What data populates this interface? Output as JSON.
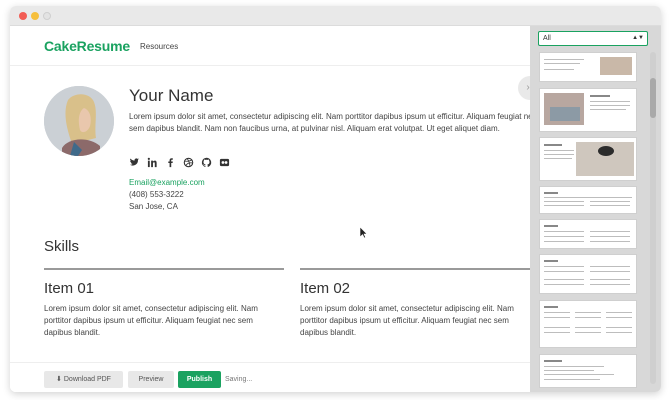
{
  "app": {
    "logo": "CakeResume",
    "nav_resources": "Resources"
  },
  "profile": {
    "name": "Your Name",
    "bio": "Lorem ipsum dolor sit amet, consectetur adipiscing elit. Nam porttitor dapibus ipsum ut efficitur. Aliquam feugiat nec sem dapibus blandit. Nam non faucibus urna, at pulvinar nisl. Aliquam erat volutpat. Ut eget aliquet diam.",
    "email": "Email@example.com",
    "phone": "(408) 553-3222",
    "city": "San Jose, CA",
    "social_icons": [
      "twitter-icon",
      "linkedin-icon",
      "facebook-icon",
      "dribbble-icon",
      "github-icon",
      "flickr-icon"
    ]
  },
  "skills": {
    "title": "Skills",
    "items": [
      {
        "title": "Item 01",
        "desc": "Lorem ipsum dolor sit amet, consectetur adipiscing elit. Nam porttitor dapibus ipsum ut efficitur. Aliquam feugiat nec sem dapibus blandit."
      },
      {
        "title": "Item 02",
        "desc": "Lorem ipsum dolor sit amet, consectetur adipiscing elit. Nam porttitor dapibus ipsum ut efficitur. Aliquam feugiat nec sem dapibus blandit."
      }
    ]
  },
  "toolbar": {
    "download_label": "Download PDF",
    "preview_label": "Preview",
    "publish_label": "Publish",
    "status": "Saving..."
  },
  "sidebar": {
    "filter_value": "All"
  },
  "colors": {
    "brand": "#1aa260"
  }
}
